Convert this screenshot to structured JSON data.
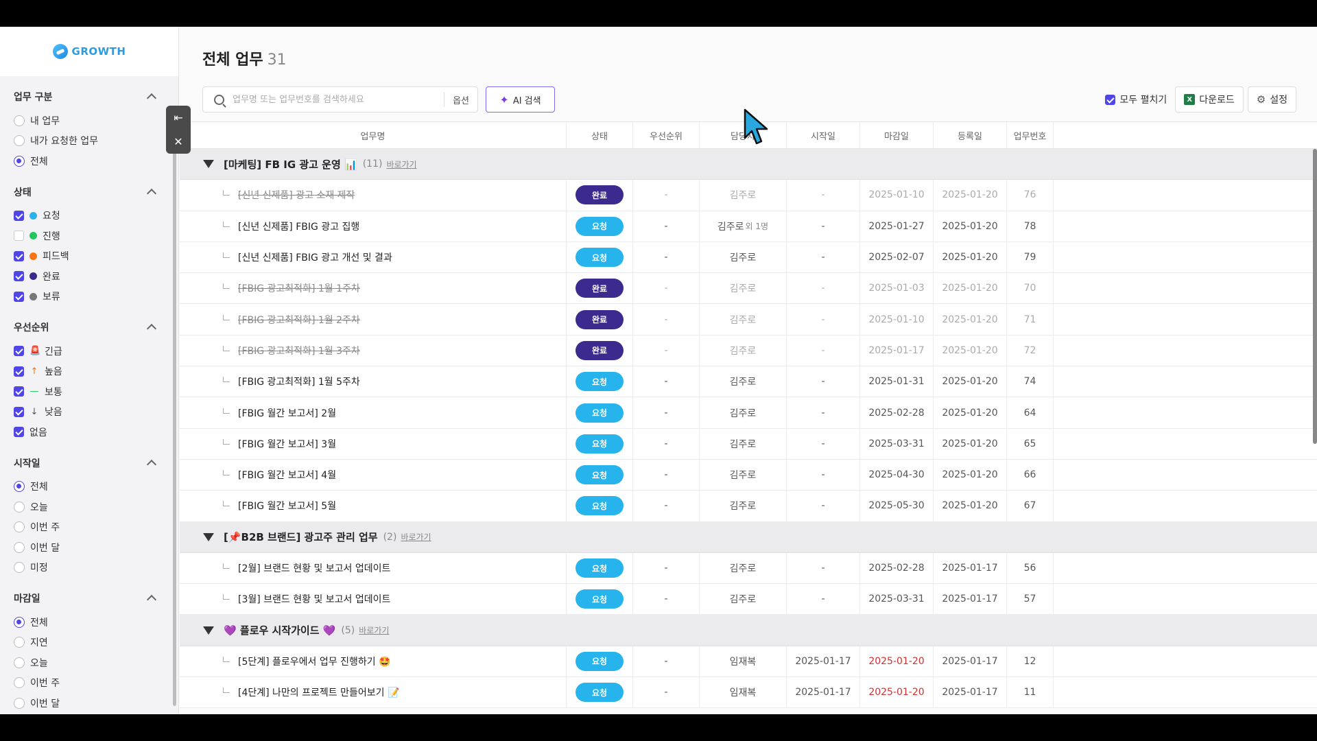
{
  "app": {
    "logo_text": "GROWTH"
  },
  "sidebar": {
    "sections": [
      {
        "title": "업무 구분",
        "type": "radio",
        "items": [
          {
            "label": "내 업무",
            "checked": false
          },
          {
            "label": "내가 요청한 업무",
            "checked": false
          },
          {
            "label": "전체",
            "checked": true
          }
        ]
      },
      {
        "title": "상태",
        "type": "checkbox",
        "items": [
          {
            "label": "요청",
            "checked": true,
            "color": "#27b3ec"
          },
          {
            "label": "진행",
            "checked": false,
            "color": "#22c55e"
          },
          {
            "label": "피드백",
            "checked": true,
            "color": "#f97316"
          },
          {
            "label": "완료",
            "checked": true,
            "color": "#3d2a8f"
          },
          {
            "label": "보류",
            "checked": true,
            "color": "#777777"
          }
        ]
      },
      {
        "title": "우선순위",
        "type": "checkbox",
        "items": [
          {
            "label": "긴급",
            "checked": true,
            "icon": "siren-icon",
            "glyph": "🚨"
          },
          {
            "label": "높음",
            "checked": true,
            "icon": "arrow-up-icon",
            "glyph": "↑"
          },
          {
            "label": "보통",
            "checked": true,
            "icon": "dash-icon",
            "glyph": "—"
          },
          {
            "label": "낮음",
            "checked": true,
            "icon": "arrow-down-icon",
            "glyph": "↓"
          },
          {
            "label": "없음",
            "checked": true
          }
        ]
      },
      {
        "title": "시작일",
        "type": "radio",
        "items": [
          {
            "label": "전체",
            "checked": true
          },
          {
            "label": "오늘",
            "checked": false
          },
          {
            "label": "이번 주",
            "checked": false
          },
          {
            "label": "이번 달",
            "checked": false
          },
          {
            "label": "미정",
            "checked": false
          }
        ]
      },
      {
        "title": "마감일",
        "type": "radio",
        "items": [
          {
            "label": "전체",
            "checked": true
          },
          {
            "label": "지연",
            "checked": false
          },
          {
            "label": "오늘",
            "checked": false
          },
          {
            "label": "이번 주",
            "checked": false
          },
          {
            "label": "이번 달",
            "checked": false
          }
        ]
      }
    ]
  },
  "header": {
    "title": "전체 업무",
    "count": "31"
  },
  "search": {
    "placeholder": "업무명 또는 업무번호를 검색하세요",
    "option_label": "옵션",
    "ai_label": "AI 검색"
  },
  "toolbar": {
    "expand_all": "모두 펼치기",
    "download": "다운로드",
    "settings": "설정"
  },
  "columns": [
    "업무명",
    "상태",
    "우선순위",
    "담당자",
    "시작일",
    "마감일",
    "등록일",
    "업무번호"
  ],
  "groups": [
    {
      "title": "[마케팅] FB IG 광고 운영 📊",
      "count": "(11)",
      "link": "바로가기",
      "rows": [
        {
          "name": "[신년 신제품] 광고 소재 제작",
          "status": "완료",
          "priority": "-",
          "assignee": "김주로",
          "extra": "",
          "start": "-",
          "due": "2025-01-10",
          "reg": "2025-01-20",
          "no": "76",
          "done": true,
          "overdue": false
        },
        {
          "name": "[신년 신제품] FBIG 광고 집행",
          "status": "요청",
          "priority": "-",
          "assignee": "김주로",
          "extra": "외 1명",
          "start": "-",
          "due": "2025-01-27",
          "reg": "2025-01-20",
          "no": "78",
          "done": false,
          "overdue": false
        },
        {
          "name": "[신년 신제품] FBIG 광고 개선 및 결과",
          "status": "요청",
          "priority": "-",
          "assignee": "김주로",
          "extra": "",
          "start": "-",
          "due": "2025-02-07",
          "reg": "2025-01-20",
          "no": "79",
          "done": false,
          "overdue": false
        },
        {
          "name": "[FBIG 광고최적화] 1월 1주차",
          "status": "완료",
          "priority": "-",
          "assignee": "김주로",
          "extra": "",
          "start": "-",
          "due": "2025-01-03",
          "reg": "2025-01-20",
          "no": "70",
          "done": true,
          "overdue": false
        },
        {
          "name": "[FBIG 광고최적화] 1월 2주차",
          "status": "완료",
          "priority": "-",
          "assignee": "김주로",
          "extra": "",
          "start": "-",
          "due": "2025-01-10",
          "reg": "2025-01-20",
          "no": "71",
          "done": true,
          "overdue": false
        },
        {
          "name": "[FBIG 광고최적화] 1월 3주차",
          "status": "완료",
          "priority": "-",
          "assignee": "김주로",
          "extra": "",
          "start": "-",
          "due": "2025-01-17",
          "reg": "2025-01-20",
          "no": "72",
          "done": true,
          "overdue": false
        },
        {
          "name": "[FBIG 광고최적화] 1월 5주차",
          "status": "요청",
          "priority": "-",
          "assignee": "김주로",
          "extra": "",
          "start": "-",
          "due": "2025-01-31",
          "reg": "2025-01-20",
          "no": "74",
          "done": false,
          "overdue": false
        },
        {
          "name": "[FBIG 월간 보고서] 2월",
          "status": "요청",
          "priority": "-",
          "assignee": "김주로",
          "extra": "",
          "start": "-",
          "due": "2025-02-28",
          "reg": "2025-01-20",
          "no": "64",
          "done": false,
          "overdue": false
        },
        {
          "name": "[FBIG 월간 보고서] 3월",
          "status": "요청",
          "priority": "-",
          "assignee": "김주로",
          "extra": "",
          "start": "-",
          "due": "2025-03-31",
          "reg": "2025-01-20",
          "no": "65",
          "done": false,
          "overdue": false
        },
        {
          "name": "[FBIG 월간 보고서] 4월",
          "status": "요청",
          "priority": "-",
          "assignee": "김주로",
          "extra": "",
          "start": "-",
          "due": "2025-04-30",
          "reg": "2025-01-20",
          "no": "66",
          "done": false,
          "overdue": false
        },
        {
          "name": "[FBIG 월간 보고서] 5월",
          "status": "요청",
          "priority": "-",
          "assignee": "김주로",
          "extra": "",
          "start": "-",
          "due": "2025-05-30",
          "reg": "2025-01-20",
          "no": "67",
          "done": false,
          "overdue": false
        }
      ]
    },
    {
      "title": "[📌B2B 브랜드] 광고주 관리 업무",
      "count": "(2)",
      "link": "바로가기",
      "rows": [
        {
          "name": "[2월] 브랜드 현황 및 보고서 업데이트",
          "status": "요청",
          "priority": "-",
          "assignee": "김주로",
          "extra": "",
          "start": "-",
          "due": "2025-02-28",
          "reg": "2025-01-17",
          "no": "56",
          "done": false,
          "overdue": false
        },
        {
          "name": "[3월] 브랜드 현황 및 보고서 업데이트",
          "status": "요청",
          "priority": "-",
          "assignee": "김주로",
          "extra": "",
          "start": "-",
          "due": "2025-03-31",
          "reg": "2025-01-17",
          "no": "57",
          "done": false,
          "overdue": false
        }
      ]
    },
    {
      "title": "💜 플로우 시작가이드 💜",
      "count": "(5)",
      "link": "바로가기",
      "rows": [
        {
          "name": "[5단계] 플로우에서 업무 진행하기 🤩",
          "status": "요청",
          "priority": "-",
          "assignee": "임재복",
          "extra": "",
          "start": "2025-01-17",
          "due": "2025-01-20",
          "reg": "2025-01-17",
          "no": "12",
          "done": false,
          "overdue": true
        },
        {
          "name": "[4단계] 나만의 프로젝트 만들어보기 📝",
          "status": "요청",
          "priority": "-",
          "assignee": "임재복",
          "extra": "",
          "start": "2025-01-17",
          "due": "2025-01-20",
          "reg": "2025-01-17",
          "no": "11",
          "done": false,
          "overdue": true
        }
      ]
    }
  ],
  "colors": {
    "accent": "#4f46e5",
    "status_done": "#3d2a8f",
    "status_request": "#27b3ec",
    "overdue": "#d32f2f"
  }
}
